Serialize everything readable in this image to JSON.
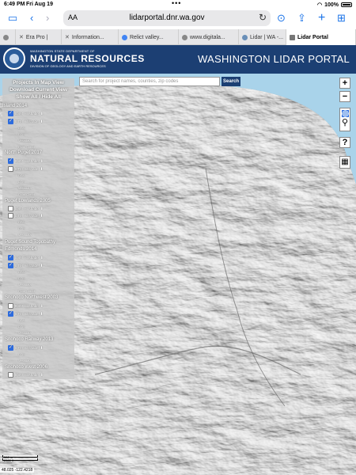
{
  "status_bar": {
    "time": "6:49 PM",
    "date": "Fri Aug 19",
    "battery": "100%"
  },
  "browser": {
    "text_size_label": "AA",
    "url": "lidarportal.dnr.wa.gov",
    "tabs": [
      {
        "label": "",
        "active": false
      },
      {
        "label": "Era Pro |",
        "active": false
      },
      {
        "label": "Information...",
        "active": false
      },
      {
        "label": "Relict valley...",
        "active": false
      },
      {
        "label": "www.digitala...",
        "active": false
      },
      {
        "label": "Lidar | WA -...",
        "active": false
      },
      {
        "label": "Lidar Portal",
        "active": true
      }
    ]
  },
  "portal": {
    "org_top": "WASHINGTON STATE DEPARTMENT OF",
    "org_main": "NATURAL RESOURCES",
    "org_sub": "DIVISION OF GEOLOGY AND EARTH RESOURCES",
    "title": "WASHINGTON LIDAR PORTAL"
  },
  "search": {
    "placeholder": "Search for project names, counties, zip codes",
    "button": "Search"
  },
  "panel": {
    "heading": "Projects In Map View",
    "download_label": "Download Current View",
    "toggle_label": "Show All / Hide All",
    "projects": [
      {
        "name": "Island 2014",
        "layers": [
          {
            "label": "DSM Hillshade",
            "checked": true
          },
          {
            "label": "DTM Hillshade",
            "checked": true
          }
        ],
        "sublayers": [
          "DSM",
          "DTM",
          "Metadata",
          "Point Cloud"
        ]
      },
      {
        "name": "North Puget 2017",
        "layers": [
          {
            "label": "DSM Hillshade",
            "checked": true
          },
          {
            "label": "DTM Hillshade",
            "checked": false
          }
        ],
        "sublayers": [
          "DSM",
          "DTM",
          "Metadata",
          "Point Cloud"
        ]
      },
      {
        "name": "Puget Lowlands 2005",
        "layers": [
          {
            "label": "DSM Hillshade",
            "checked": false
          },
          {
            "label": "DTM Hillshade",
            "checked": false
          }
        ],
        "sublayers": [
          "DSM",
          "DTM",
          "Metadata"
        ]
      },
      {
        "name": "Puget Sound Topobathy",
        "layers": [],
        "sublayers": []
      },
      {
        "name": "Edmonds 2014",
        "layers": [
          {
            "label": "DSM Hillshade",
            "checked": true
          },
          {
            "label": "DTM Hillshade",
            "checked": true
          }
        ],
        "sublayers": [
          "DSM",
          "DTM",
          "Metadata",
          "Point Cloud"
        ]
      },
      {
        "name": "Snohoco Northwest 2003",
        "layers": [
          {
            "label": "DSM Hillshade",
            "checked": false
          },
          {
            "label": "DTM Hillshade",
            "checked": true
          }
        ],
        "sublayers": [
          "DSM",
          "DTM",
          "Metadata"
        ]
      },
      {
        "name": "Snohoco Railway 2013",
        "layers": [
          {
            "label": "DTM Hillshade",
            "checked": true
          }
        ],
        "sublayers": [
          "DTM",
          "Metadata"
        ]
      },
      {
        "name": "Snohoco West 2006",
        "layers": [
          {
            "label": "DSM Hillshade",
            "checked": false
          }
        ],
        "sublayers": []
      }
    ]
  },
  "map_controls": {
    "zoom_in": "+",
    "zoom_out": "−",
    "help": "?"
  },
  "scale": {
    "top": "500 m",
    "bottom": "2000 ft"
  },
  "coordinates": "48.025  -122.4218",
  "colors": {
    "header_bg": "#1c3f73",
    "water": "#a9d3ea",
    "accent": "#1a73e8"
  }
}
